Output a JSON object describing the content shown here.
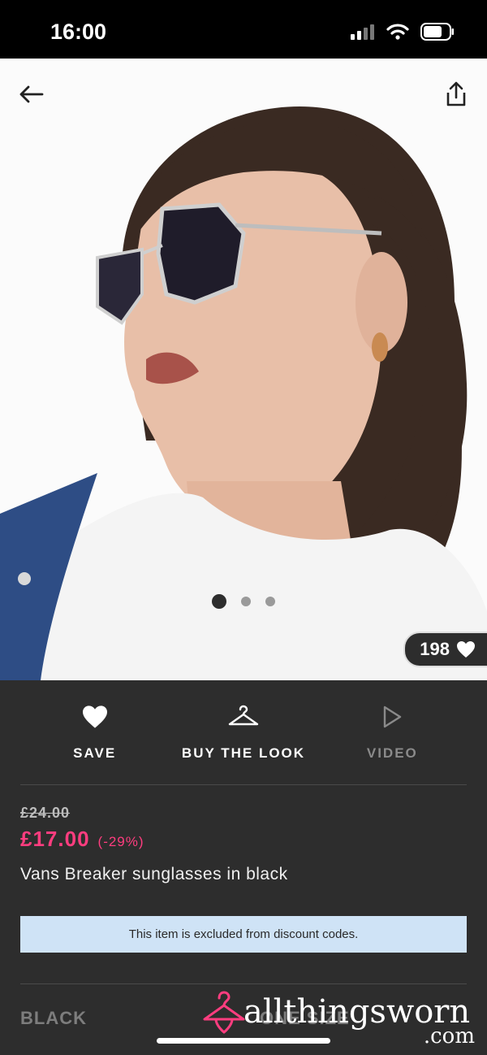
{
  "status_bar": {
    "time": "16:00"
  },
  "product_image": {
    "alt": "",
    "carousel_count": 3,
    "active_index": 0
  },
  "likes": {
    "count": "198"
  },
  "actions": [
    {
      "label": "SAVE",
      "icon": "heart-icon"
    },
    {
      "label": "BUY THE LOOK",
      "icon": "hanger-icon"
    },
    {
      "label": "VIDEO",
      "icon": "play-icon"
    }
  ],
  "price": {
    "original": "£24.00",
    "current": "£17.00",
    "discount": "(-29%)"
  },
  "product": {
    "title": "Vans Breaker sunglasses in black"
  },
  "notice": {
    "text": "This item is excluded from discount codes."
  },
  "options": {
    "colour": "BLACK",
    "size": "ONE SIZE"
  },
  "watermark": {
    "name": "allthingsworn",
    "tld": ".com"
  },
  "colors": {
    "accent": "#ff3d7f",
    "notice_bg": "#cfe3f6",
    "panel_bg": "#2d2d2d"
  }
}
